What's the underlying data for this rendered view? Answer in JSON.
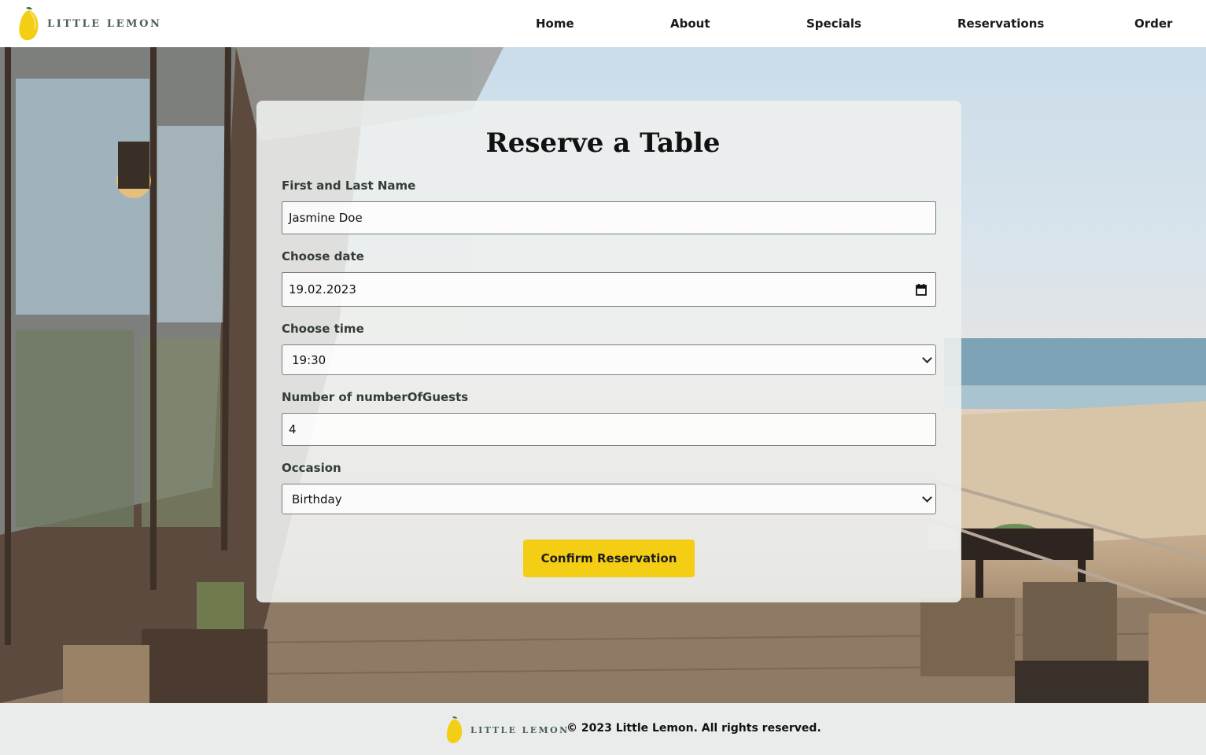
{
  "brand": {
    "name": "Little Lemon",
    "logo_icon": "lemon-icon"
  },
  "nav": {
    "items": [
      {
        "label": "Home"
      },
      {
        "label": "About"
      },
      {
        "label": "Specials"
      },
      {
        "label": "Reservations"
      },
      {
        "label": "Order"
      }
    ]
  },
  "form": {
    "title": "Reserve a Table",
    "name_label": "First and Last Name",
    "name_value": "Jasmine Doe",
    "date_label": "Choose date",
    "date_value": "19.02.2023",
    "date_icon": "calendar-icon",
    "time_label": "Choose time",
    "time_value": "19:30",
    "guests_label": "Number of numberOfGuests",
    "guests_value": "4",
    "occasion_label": "Occasion",
    "occasion_value": "Birthday",
    "submit_label": "Confirm Reservation"
  },
  "footer": {
    "brand": "Little Lemon",
    "copyright": "© 2023 Little Lemon. All rights reserved."
  },
  "colors": {
    "accent": "#f4ce14",
    "brand_green": "#495e57",
    "card": "#edefee",
    "footer_bg": "#e9ecea"
  }
}
